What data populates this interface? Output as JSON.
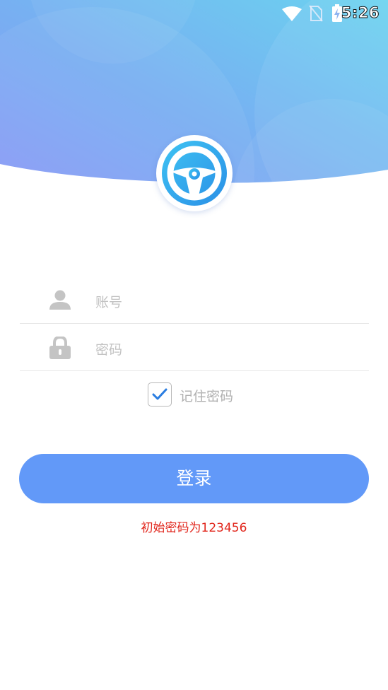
{
  "status_bar": {
    "time": "5:26",
    "icons": [
      "wifi-icon",
      "no-sim-icon",
      "battery-charging-icon"
    ]
  },
  "logo": {
    "icon": "steering-wheel-icon"
  },
  "form": {
    "account_placeholder": "账号",
    "account_icon": "user-icon",
    "password_placeholder": "密码",
    "password_icon": "lock-icon",
    "remember_label": "记住密码",
    "remember_checked": true
  },
  "login_button": "登录",
  "hint": "初始密码为123456",
  "colors": {
    "primary": "#6299f8",
    "header_start": "#8a9af5",
    "header_end": "#6ed0f0",
    "hint": "#e1261c",
    "check": "#2a7de1"
  }
}
